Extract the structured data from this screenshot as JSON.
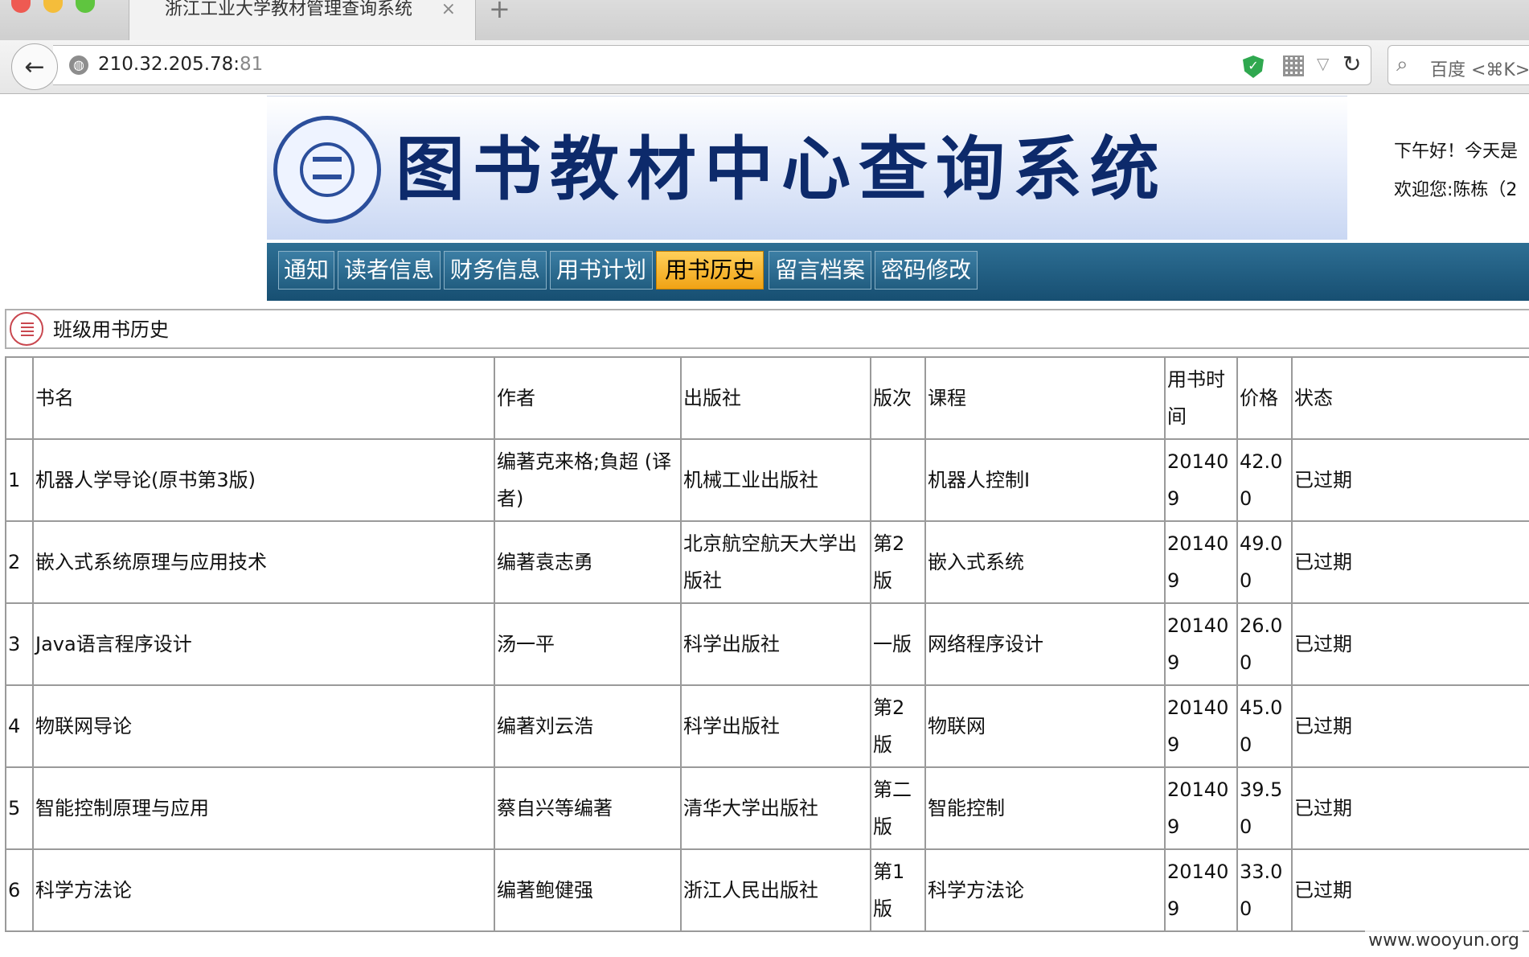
{
  "browser": {
    "tab_title": "浙江工业大学教材管理查询系统",
    "tab_close": "×",
    "new_tab": "+",
    "url_host": "210.32.205.78:",
    "url_port": "81",
    "search_placeholder": "百度 <⌘K>",
    "back_glyph": "←",
    "reload_glyph": "↻",
    "dropdown_glyph": "▽",
    "search_glyph": "⌕"
  },
  "header": {
    "system_title": "图书教材中心查询系统",
    "greeting_line1": "下午好！今天是",
    "greeting_line2": "欢迎您:陈栋（2"
  },
  "menu": [
    {
      "label": "通知"
    },
    {
      "label": "读者信息"
    },
    {
      "label": "财务信息"
    },
    {
      "label": "用书计划"
    },
    {
      "label": "用书历史",
      "active": true
    },
    {
      "label": "留言档案"
    },
    {
      "label": "密码修改"
    }
  ],
  "section": {
    "title": "班级用书历史"
  },
  "table": {
    "headers": [
      "",
      "书名",
      "作者",
      "出版社",
      "版次",
      "课程",
      "用书时间",
      "价格",
      "状态"
    ],
    "rows": [
      [
        "1",
        "机器人学导论(原书第3版)",
        "编著克来格;負超 (译者)",
        "机械工业出版社",
        "",
        "机器人控制I",
        "201409",
        "42.00",
        "已过期"
      ],
      [
        "2",
        "嵌入式系统原理与应用技术",
        "编著袁志勇",
        "北京航空航天大学出版社",
        "第2版",
        "嵌入式系统",
        "201409",
        "49.00",
        "已过期"
      ],
      [
        "3",
        "Java语言程序设计",
        "汤一平",
        "科学出版社",
        "一版",
        "网络程序设计",
        "201409",
        "26.00",
        "已过期"
      ],
      [
        "4",
        "物联网导论",
        "编著刘云浩",
        "科学出版社",
        "第2版",
        "物联网",
        "201409",
        "45.00",
        "已过期"
      ],
      [
        "5",
        "智能控制原理与应用",
        "蔡自兴等编著",
        "清华大学出版社",
        "第二版",
        "智能控制",
        "201409",
        "39.50",
        "已过期"
      ],
      [
        "6",
        "科学方法论",
        "编著鲍健强",
        "浙江人民出版社",
        "第1版",
        "科学方法论",
        "201409",
        "33.00",
        "已过期"
      ]
    ]
  },
  "watermark_site": "www.wooyun.org"
}
